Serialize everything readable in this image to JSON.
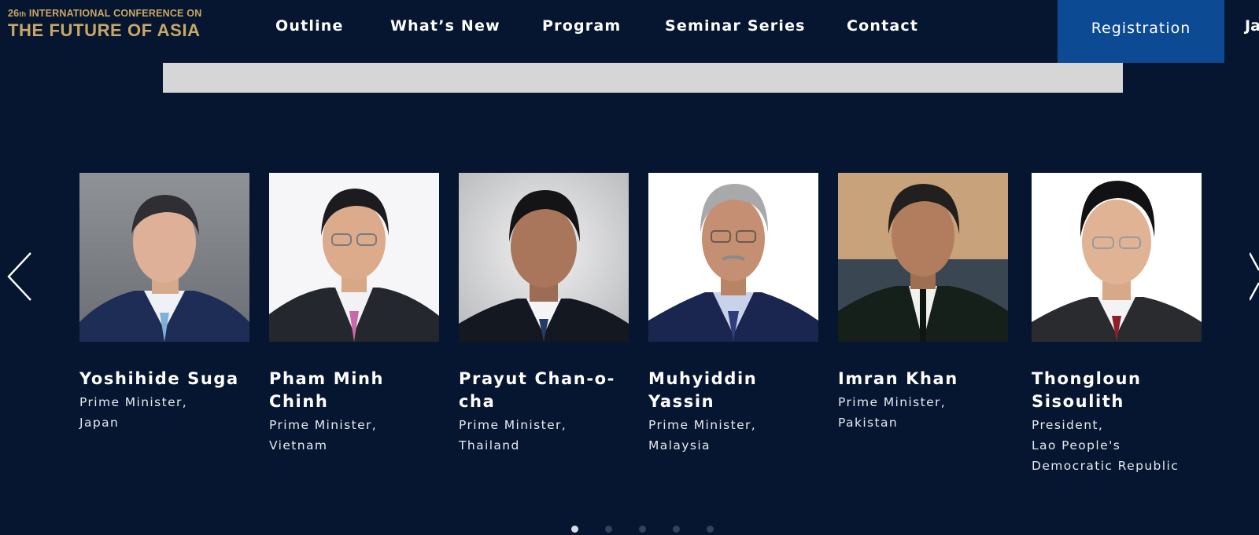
{
  "header": {
    "logo_number": "26",
    "logo_suffix": "th",
    "logo_line1_rest": " INTERNATIONAL CONFERENCE ON",
    "logo_line2": "THE FUTURE OF ASIA",
    "nav": [
      {
        "label": "Outline"
      },
      {
        "label": "What’s New"
      },
      {
        "label": "Program"
      },
      {
        "label": "Seminar Series"
      },
      {
        "label": "Contact"
      }
    ],
    "registration_label": "Registration",
    "language_label": "Ja"
  },
  "carousel": {
    "speakers": [
      {
        "name": "Yoshihide Suga",
        "role_line1": "Prime Minister,",
        "role_line2": "Japan",
        "role_line3": ""
      },
      {
        "name": "Pham Minh Chinh",
        "role_line1": "Prime Minister,",
        "role_line2": "Vietnam",
        "role_line3": ""
      },
      {
        "name": "Prayut Chan-o-cha",
        "role_line1": "Prime Minister,",
        "role_line2": "Thailand",
        "role_line3": ""
      },
      {
        "name": "Muhyiddin Yassin",
        "role_line1": "Prime Minister,",
        "role_line2": "Malaysia",
        "role_line3": ""
      },
      {
        "name": "Imran Khan",
        "role_line1": "Prime Minister,",
        "role_line2": "Pakistan",
        "role_line3": ""
      },
      {
        "name": "Thongloun Sisoulith",
        "role_line1": "President,",
        "role_line2": "Lao People's",
        "role_line3": "Democratic Republic"
      }
    ],
    "page_count": 5,
    "active_page": 1
  },
  "colors": {
    "background": "#061630",
    "logo_gold": "#c9a866",
    "registration_blue": "#0c4a94",
    "banner_gray": "#d6d6d6"
  },
  "icons": {
    "prev": "chevron-left-icon",
    "next": "chevron-right-icon"
  }
}
